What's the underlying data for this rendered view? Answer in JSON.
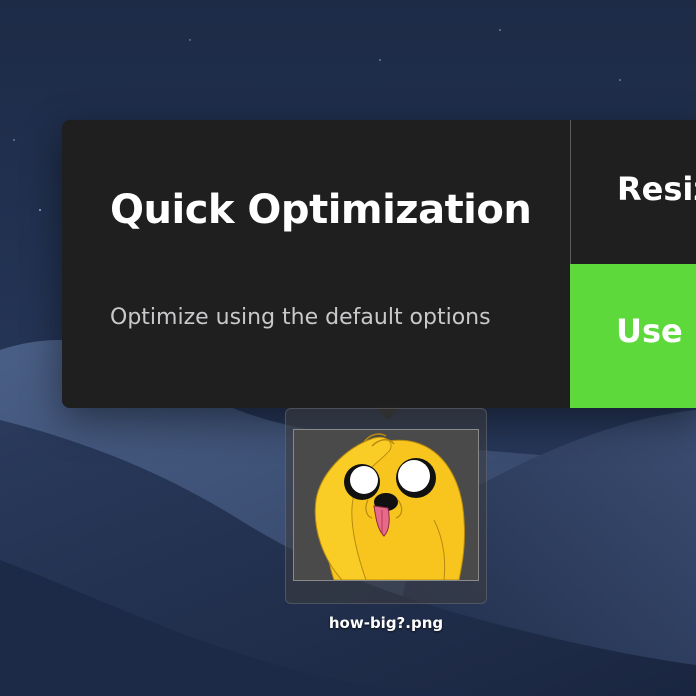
{
  "popup": {
    "quick_title": "Quick Optimization",
    "quick_subtitle": "Optimize using the default options",
    "resize_label": "Resiz",
    "use_label": "Use I"
  },
  "file": {
    "name": "how-big?.png",
    "thumbnail_icon": "jake-the-dog-thumbnail"
  },
  "colors": {
    "popup_bg": "#1f1f20",
    "accent_green": "#5ed93c",
    "desktop_sky": "#1b2640"
  }
}
